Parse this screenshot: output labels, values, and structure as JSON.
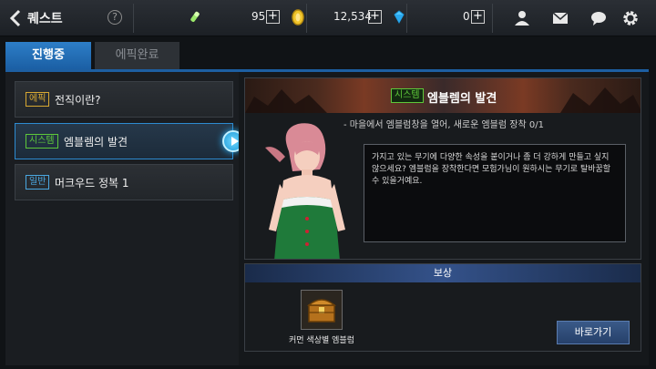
{
  "header": {
    "title": "퀘스트",
    "help": "?",
    "energy": "95",
    "gold": "12,534",
    "gems": "0",
    "plus": "+"
  },
  "tabs": [
    {
      "label": "진행중",
      "active": true
    },
    {
      "label": "에픽완료",
      "active": false
    }
  ],
  "quests": [
    {
      "tag": "에픽",
      "tag_color": "#d7a832",
      "name": "전직이란?"
    },
    {
      "tag": "시스템",
      "tag_color": "#5ec83a",
      "name": "엠블렘의 발견",
      "selected": true
    },
    {
      "tag": "일반",
      "tag_color": "#4aa7e0",
      "name": "머크우드 정복 1"
    }
  ],
  "detail": {
    "tag": "시스템",
    "title": "엠블렘의 발견",
    "objective": "- 마을에서 엠블럼창을 열어, 새로운 엠블럼 장착 0/1",
    "dialog": "가지고 있는 무기에 다양한 속성을 붙이거나 좀 더 강하게 만들고 싶지 않으세요? 엠블럼을 장착한다면 모험가님이 원하시는 무기로 탈바꿈할 수 있을거예요."
  },
  "reward": {
    "header": "보상",
    "item_name": "커먼 색상별 엠블럼",
    "button": "바로가기"
  },
  "icons": {
    "energy": "energy-icon",
    "gold": "gold-coin-icon",
    "gem": "gem-icon",
    "friends": "friends-icon",
    "mail": "mail-icon",
    "chat": "chat-icon",
    "settings": "gear-icon"
  }
}
